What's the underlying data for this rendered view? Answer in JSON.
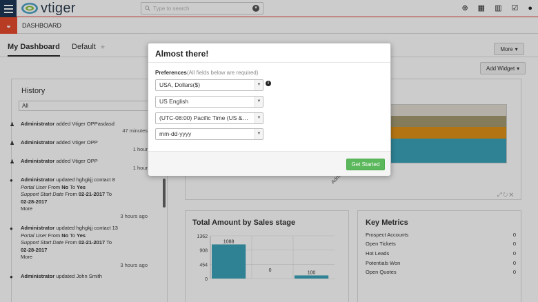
{
  "app": {
    "name": "vtiger"
  },
  "search": {
    "placeholder": "Type to search"
  },
  "topbar": {
    "icons": [
      "plus-circle-icon",
      "calendar-icon",
      "chart-icon",
      "checkbox-icon",
      "user-icon"
    ]
  },
  "module": {
    "name": "DASHBOARD"
  },
  "tabs": [
    {
      "label": "My Dashboard",
      "active": true
    },
    {
      "label": "Default",
      "active": false
    }
  ],
  "buttons": {
    "more": "More",
    "add_widget": "Add Widget"
  },
  "history": {
    "title": "History",
    "filter": "All",
    "items": [
      {
        "html_parts": {
          "actor": "Administrator",
          "text": " added Vtiger OPPasdasd"
        },
        "time": "47 minutes"
      },
      {
        "html_parts": {
          "actor": "Administrator",
          "text": " added Vtiger OPP"
        },
        "time": "1 hour"
      },
      {
        "html_parts": {
          "actor": "Administrator",
          "text": " added Vtiger OPP"
        },
        "time": "1 hour"
      },
      {
        "html_parts": {
          "actor": "Administrator",
          "text": " updated hghgkjj contact 8"
        },
        "lines": [
          {
            "field": "Portal User",
            "from_label": "From",
            "from": "No",
            "to_label": "To",
            "to": "Yes"
          },
          {
            "field": "Support Start Date",
            "from_label": "From",
            "from": "02-21-2017",
            "to_label": "To",
            "to": "02-28-2017"
          }
        ],
        "more": "More",
        "time": "3 hours ago"
      },
      {
        "html_parts": {
          "actor": "Administrator",
          "text": " updated hghgkjj contact 13"
        },
        "lines": [
          {
            "field": "Portal User",
            "from_label": "From",
            "from": "No",
            "to_label": "To",
            "to": "Yes"
          },
          {
            "field": "Support Start Date",
            "from_label": "From",
            "from": "02-21-2017",
            "to_label": "To",
            "to": "02-28-2017"
          }
        ],
        "more": "More",
        "time": "3 hours ago"
      },
      {
        "html_parts": {
          "actor": "Administrator",
          "text": " updated John Smith"
        },
        "time": ""
      }
    ]
  },
  "chart1": {
    "x_label": "Admin",
    "band_colors": [
      "#e2dcd3",
      "#a59a72",
      "#e0921a",
      "#3aa3b8"
    ]
  },
  "sales_widget": {
    "title": "Total Amount by Sales stage",
    "chart_data": {
      "type": "bar",
      "categories": [
        "",
        "",
        ""
      ],
      "values": [
        1088,
        0,
        100
      ],
      "ylim": [
        0,
        1362
      ],
      "yticks": [
        "1362",
        "908",
        "454",
        "0"
      ],
      "data_labels": [
        "1088",
        "0",
        "100"
      ],
      "colors": [
        "#3aa3b8"
      ]
    }
  },
  "metrics_widget": {
    "title": "Key Metrics",
    "rows": [
      {
        "label": "Prospect Accounts",
        "value": "0"
      },
      {
        "label": "Open Tickets",
        "value": "0"
      },
      {
        "label": "Hot Leads",
        "value": "0"
      },
      {
        "label": "Potentials Won",
        "value": "0"
      },
      {
        "label": "Open Quotes",
        "value": "0"
      }
    ]
  },
  "modal": {
    "title": "Almost there!",
    "pref_label": "Preferences",
    "pref_note": "(All fields below are required)",
    "currency": "USA, Dollars($)",
    "language": "US English",
    "timezone": "(UTC-08:00) Pacific Time (US &…",
    "date_format": "mm-dd-yyyy",
    "button": "Get Started"
  }
}
